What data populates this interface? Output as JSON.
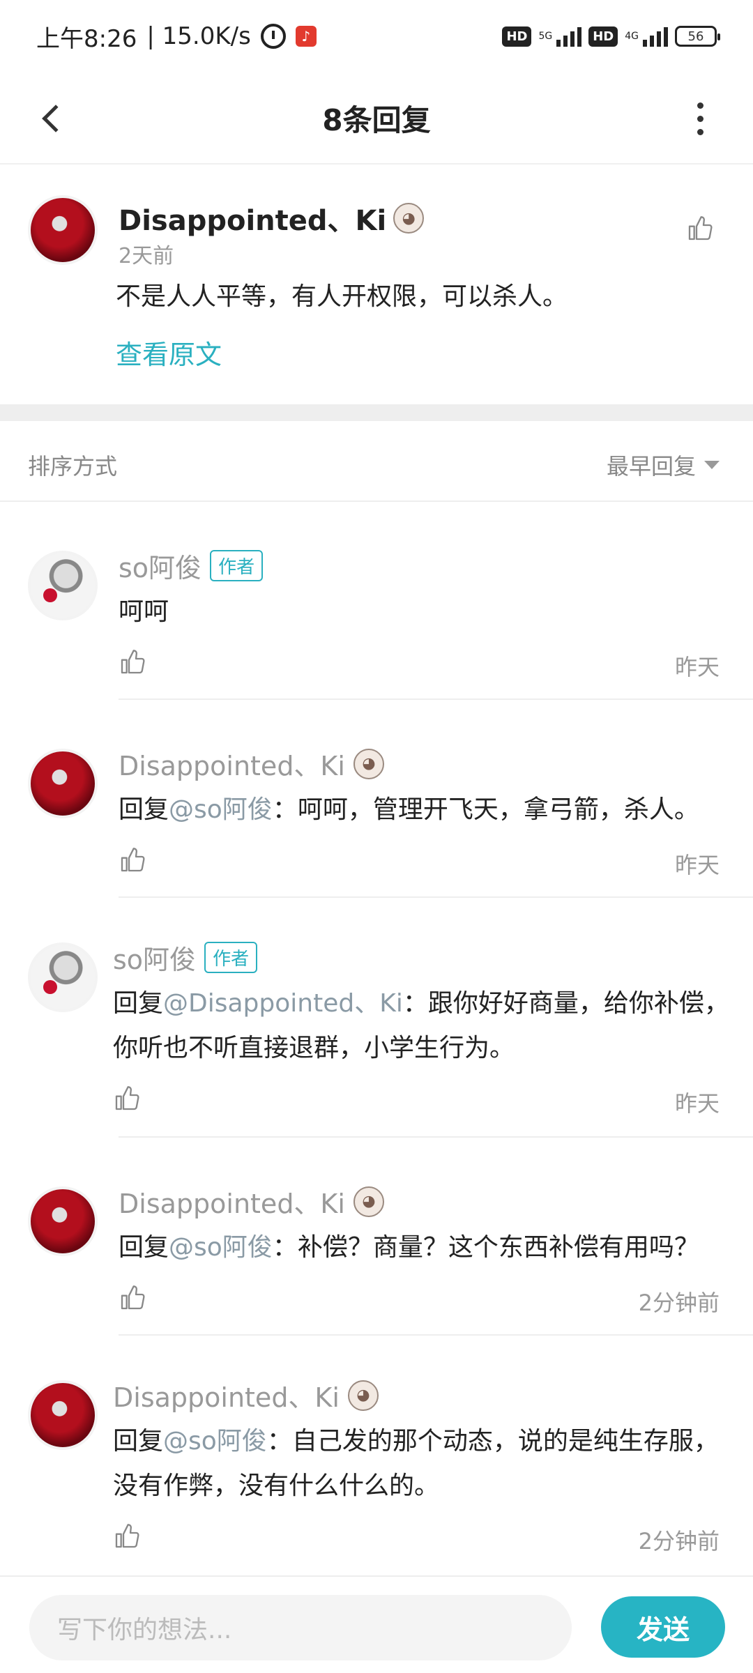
{
  "status_bar": {
    "time": "上午8:26",
    "speed": "| 15.0K/s",
    "hd1": "HD",
    "net1": "5G",
    "hd2": "HD",
    "net2": "4G",
    "battery": "56"
  },
  "header": {
    "title": "8条回复"
  },
  "original": {
    "username": "Disappointed、Ki",
    "time": "2天前",
    "text": "不是人人平等，有人开权限，可以杀人。",
    "view_original": "查看原文"
  },
  "sort": {
    "label": "排序方式",
    "value": "最早回复"
  },
  "replies": [
    {
      "username": "so阿俊",
      "author_tag": "作者",
      "prefix": "",
      "mention": "",
      "text": "呵呵",
      "time": "昨天"
    },
    {
      "username": "Disappointed、Ki",
      "author_tag": "",
      "prefix": "回复",
      "mention": "@so阿俊",
      "text": "：呵呵，管理开飞天，拿弓箭，杀人。",
      "time": "昨天"
    },
    {
      "username": "so阿俊",
      "author_tag": "作者",
      "prefix": "回复",
      "mention": "@Disappointed、Ki",
      "text": "：跟你好好商量，给你补偿，你听也不听直接退群，小学生行为。",
      "time": "昨天"
    },
    {
      "username": "Disappointed、Ki",
      "author_tag": "",
      "prefix": "回复",
      "mention": "@so阿俊",
      "text": "：补偿？商量？这个东西补偿有用吗？",
      "time": "2分钟前"
    },
    {
      "username": "Disappointed、Ki",
      "author_tag": "",
      "prefix": "回复",
      "mention": "@so阿俊",
      "text": "：自己发的那个动态，说的是纯生存服，没有作弊，没有什么什么的。",
      "time": "2分钟前"
    }
  ],
  "bottom": {
    "placeholder": "写下你的想法...",
    "send_label": "发送"
  },
  "colors": {
    "accent": "#27b4c4",
    "mention": "#8a9aa5"
  }
}
